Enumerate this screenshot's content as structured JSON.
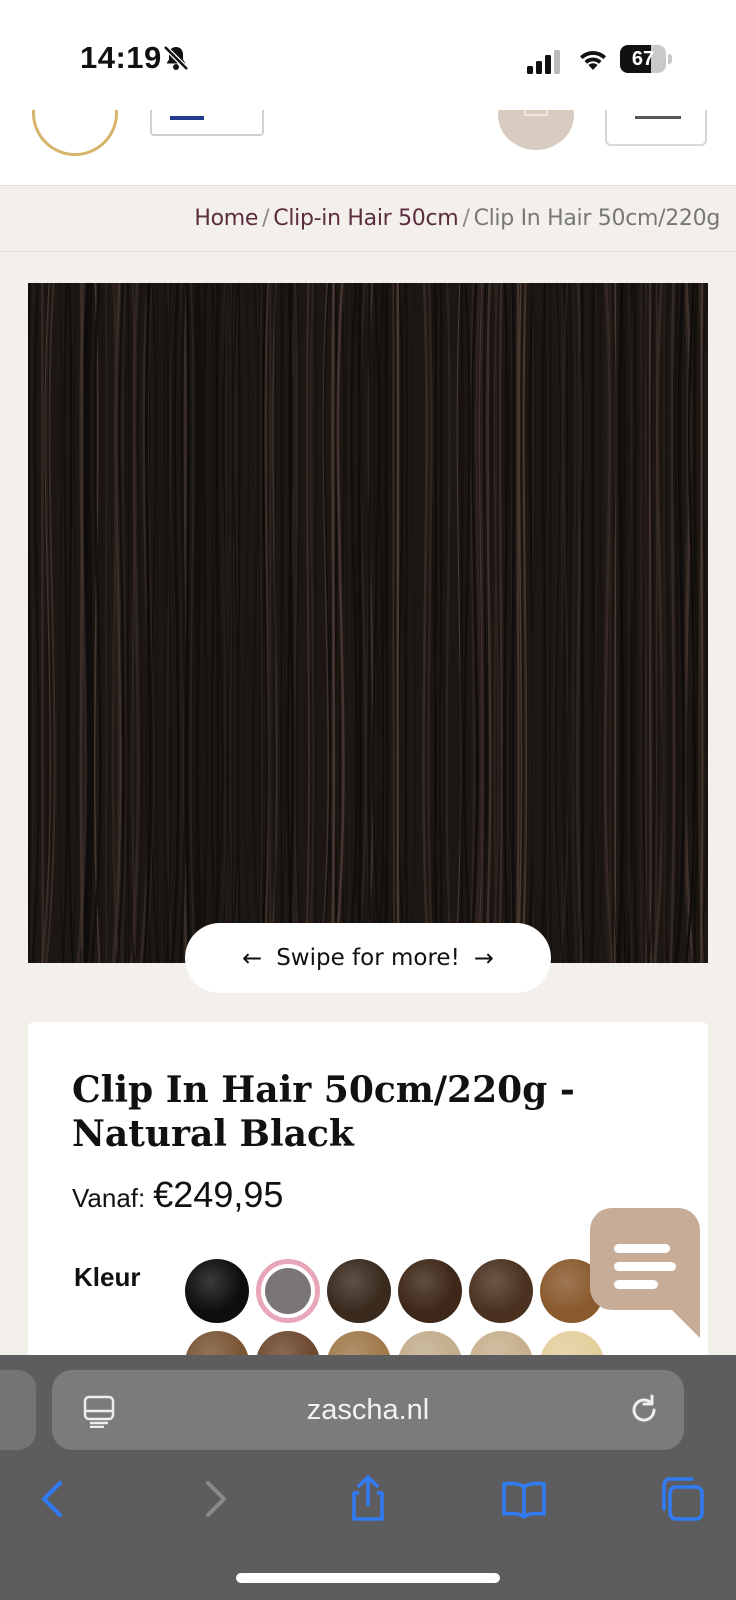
{
  "status_bar": {
    "time": "14:19",
    "battery": "67",
    "battery_level": 0.67,
    "icons": [
      "bell-slash-icon",
      "cellular-signal-icon",
      "wifi-icon",
      "battery-icon"
    ]
  },
  "header": {
    "logo": "zascha-logo",
    "icons": [
      "language-flag-icon",
      "cart-icon",
      "menu-icon"
    ]
  },
  "breadcrumb": {
    "items": [
      "Home",
      "Clip-in Hair 50cm",
      "Clip In Hair 50cm/220g"
    ],
    "separator": "/"
  },
  "gallery": {
    "swipe_label": "Swipe for more!",
    "left_arrow": "←",
    "right_arrow": "→"
  },
  "product": {
    "title": "Clip In Hair 50cm/220g - Natural Black",
    "price_label": "Vanaf:",
    "price": "€249,95",
    "color_label": "Kleur",
    "swatches": [
      {
        "color": "#0e0e0e",
        "selected": false
      },
      {
        "color": "#7a7676",
        "selected": true
      },
      {
        "color": "#3a2a1e",
        "selected": false
      },
      {
        "color": "#3d2718",
        "selected": false
      },
      {
        "color": "#4b3220",
        "selected": false
      },
      {
        "color": "#8a5a2e",
        "selected": false
      },
      {
        "color": "#7a5635",
        "selected": false
      },
      {
        "color": "#6e4a30",
        "selected": false
      },
      {
        "color": "#a07a4c",
        "selected": false
      },
      {
        "color": "#c2ad8c",
        "selected": false
      },
      {
        "color": "#c7b08e",
        "selected": false
      },
      {
        "color": "#e3cf9d",
        "selected": false
      }
    ]
  },
  "chat": {
    "icon": "chat-bubble-icon",
    "color": "#c7ad98"
  },
  "browser": {
    "url": "zascha.nl",
    "icons": [
      "reader-mode-icon",
      "reload-icon",
      "back-icon",
      "forward-icon",
      "share-icon",
      "bookmarks-icon",
      "tabs-icon"
    ],
    "accent": "#2f7cf6"
  }
}
